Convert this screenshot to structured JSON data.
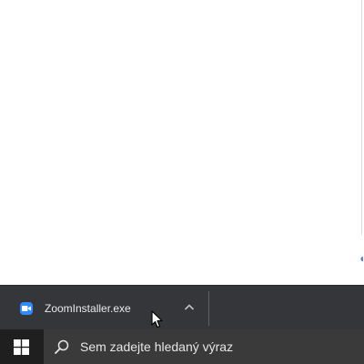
{
  "download_bar": {
    "item": {
      "filename": "ZoomInstaller.exe",
      "icon": "zoom-app-icon",
      "menu_icon": "chevron-up-icon"
    }
  },
  "taskbar": {
    "start_icon": "windows-logo-icon",
    "search": {
      "icon": "search-icon",
      "placeholder": "Sem zadejte hledaný výraz"
    }
  },
  "colors": {
    "download_bar_bg": "#35363a",
    "taskbar_bg": "#1f1f1f",
    "search_bg": "#3a3a3a",
    "zoom_blue": "#2d8cff"
  }
}
